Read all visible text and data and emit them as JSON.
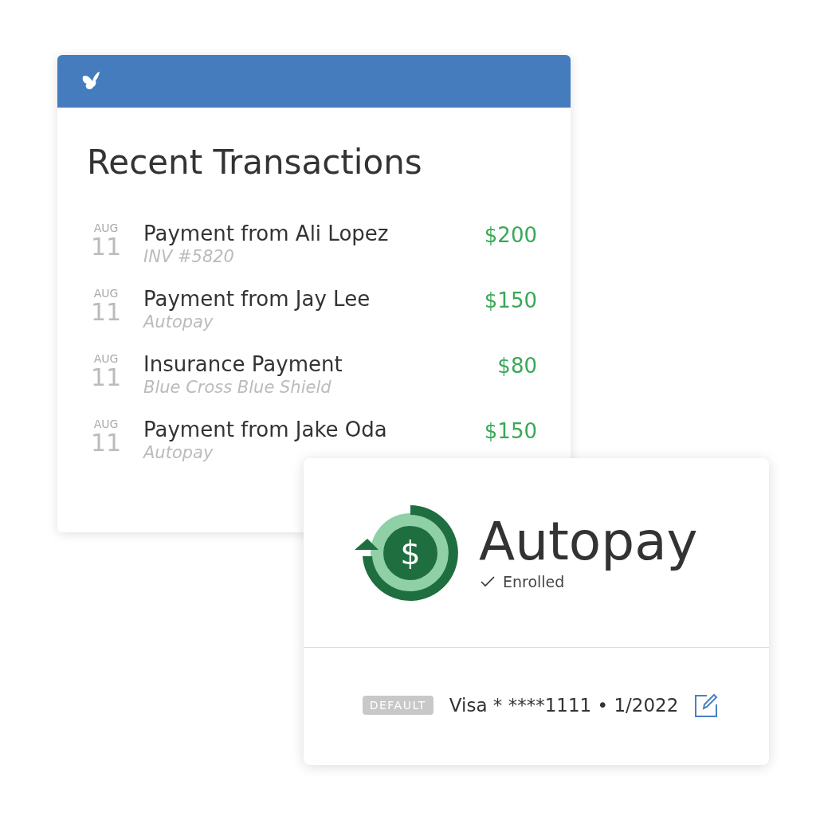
{
  "transactions_card": {
    "title": "Recent Transactions",
    "transactions": [
      {
        "month": "AUG",
        "day": "11",
        "title": "Payment from Ali Lopez",
        "subtitle": "INV #5820",
        "amount": "$200"
      },
      {
        "month": "AUG",
        "day": "11",
        "title": "Payment from Jay Lee",
        "subtitle": "Autopay",
        "amount": "$150"
      },
      {
        "month": "AUG",
        "day": "11",
        "title": "Insurance Payment",
        "subtitle": "Blue Cross Blue Shield",
        "amount": "$80"
      },
      {
        "month": "AUG",
        "day": "11",
        "title": "Payment from Jake Oda",
        "subtitle": "Autopay",
        "amount": "$150"
      }
    ]
  },
  "autopay_card": {
    "icon_symbol": "$",
    "title": "Autopay",
    "status": "Enrolled",
    "enrolled": true,
    "badge": "DEFAULT",
    "payment_method": "Visa * ****1111 • 1/2022"
  }
}
